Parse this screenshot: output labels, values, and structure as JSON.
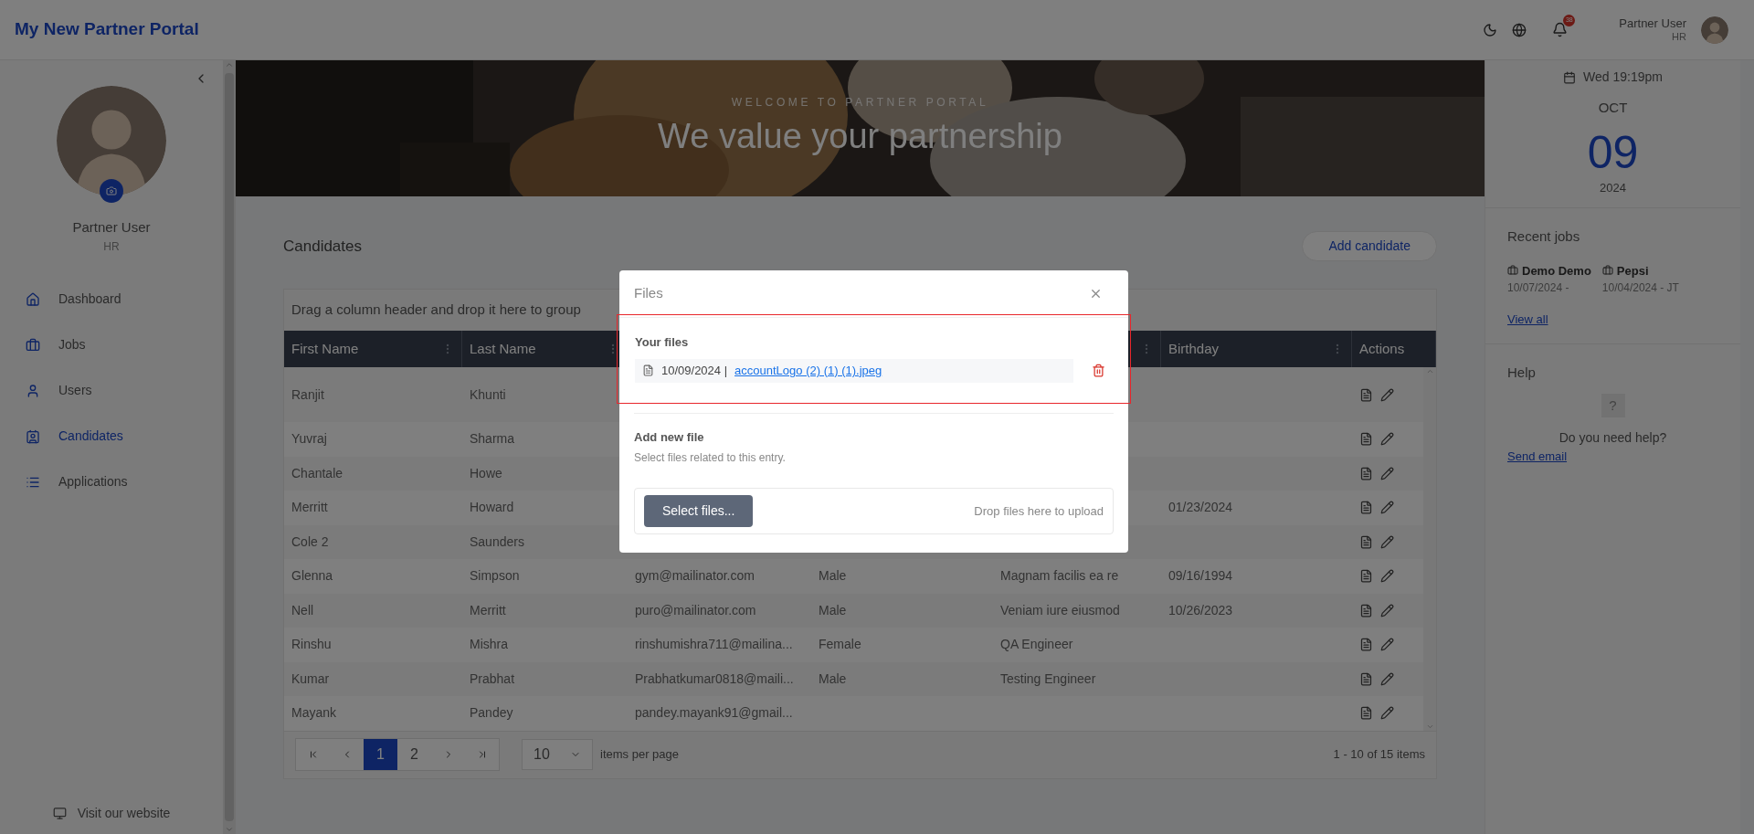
{
  "header": {
    "title": "My New Partner Portal",
    "notifications": "38",
    "user_name": "Partner User",
    "user_role": "HR"
  },
  "sidebar": {
    "user_name": "Partner User",
    "user_role": "HR",
    "items": [
      {
        "label": "Dashboard",
        "selected": false
      },
      {
        "label": "Jobs",
        "selected": false
      },
      {
        "label": "Users",
        "selected": false
      },
      {
        "label": "Candidates",
        "selected": true
      },
      {
        "label": "Applications",
        "selected": false
      }
    ],
    "footer_link": "Visit our website"
  },
  "banner": {
    "eyebrow": "WELCOME TO PARTNER PORTAL",
    "headline": "We value your partnership"
  },
  "candidates": {
    "title": "Candidates",
    "add_button": "Add candidate",
    "group_hint": "Drag a column header and drop it here to group",
    "columns": [
      {
        "label": "First Name",
        "menu": true
      },
      {
        "label": "Last Name",
        "menu": true
      },
      null,
      null,
      {
        "menu": true
      },
      {
        "label": "Birthday",
        "menu": true
      },
      {
        "label": "Actions",
        "menu": false
      }
    ],
    "rows": [
      {
        "first": "Ranjit",
        "last": "Khunti"
      },
      {
        "first": "Yuvraj",
        "last": "Sharma"
      },
      {
        "first": "Chantale",
        "last": "Howe"
      },
      {
        "first": "Merritt",
        "last": "Howard",
        "birthday": "01/23/2024"
      },
      {
        "first": "Cole 2",
        "last": "Saunders"
      },
      {
        "first": "Glenna",
        "last": "Simpson",
        "email": "gym@mailinator.com",
        "gender": "Male",
        "job": "Magnam facilis ea re",
        "birthday": "09/16/1994"
      },
      {
        "first": "Nell",
        "last": "Merritt",
        "email": "puro@mailinator.com",
        "gender": "Male",
        "job": "Veniam iure eiusmod",
        "birthday": "10/26/2023"
      },
      {
        "first": "Rinshu",
        "last": "Mishra",
        "email": "rinshumishra711@mailina...",
        "gender": "Female",
        "job": "QA Engineer"
      },
      {
        "first": "Kumar",
        "last": "Prabhat",
        "email": "Prabhatkumar0818@maili...",
        "gender": "Male",
        "job": "Testing Engineer"
      },
      {
        "first": "Mayank",
        "last": "Pandey",
        "email": "pandey.mayank91@gmail..."
      }
    ],
    "pager": {
      "pages": [
        {
          "label": "1",
          "selected": true
        },
        {
          "label": "2",
          "selected": false
        }
      ],
      "page_size": "10",
      "page_size_label": "items per page",
      "summary": "1 - 10 of 15 items"
    }
  },
  "right_panel": {
    "date": "Wed 19:19pm",
    "month": "OCT",
    "day": "09",
    "year": "2024",
    "recent_title": "Recent jobs",
    "jobs": [
      {
        "name": "Demo Demo",
        "detail": "10/07/2024 -"
      },
      {
        "name": "Pepsi",
        "detail": "10/04/2024 - JT"
      }
    ],
    "view_all": "View all",
    "help_title": "Help",
    "help_mark": "?",
    "help_text": "Do you need help?",
    "send_email": "Send email"
  },
  "modal": {
    "title": "Files",
    "your_files": {
      "label": "Your files",
      "highlighted": true,
      "files": [
        {
          "date": "10/09/2024 |",
          "name": "accountLogo (2) (1) (1).jpeg"
        }
      ]
    },
    "add_title": "Add new file",
    "add_hint": "Select files related to this entry.",
    "select_button": "Select files...",
    "drop_hint": "Drop files here to upload"
  }
}
